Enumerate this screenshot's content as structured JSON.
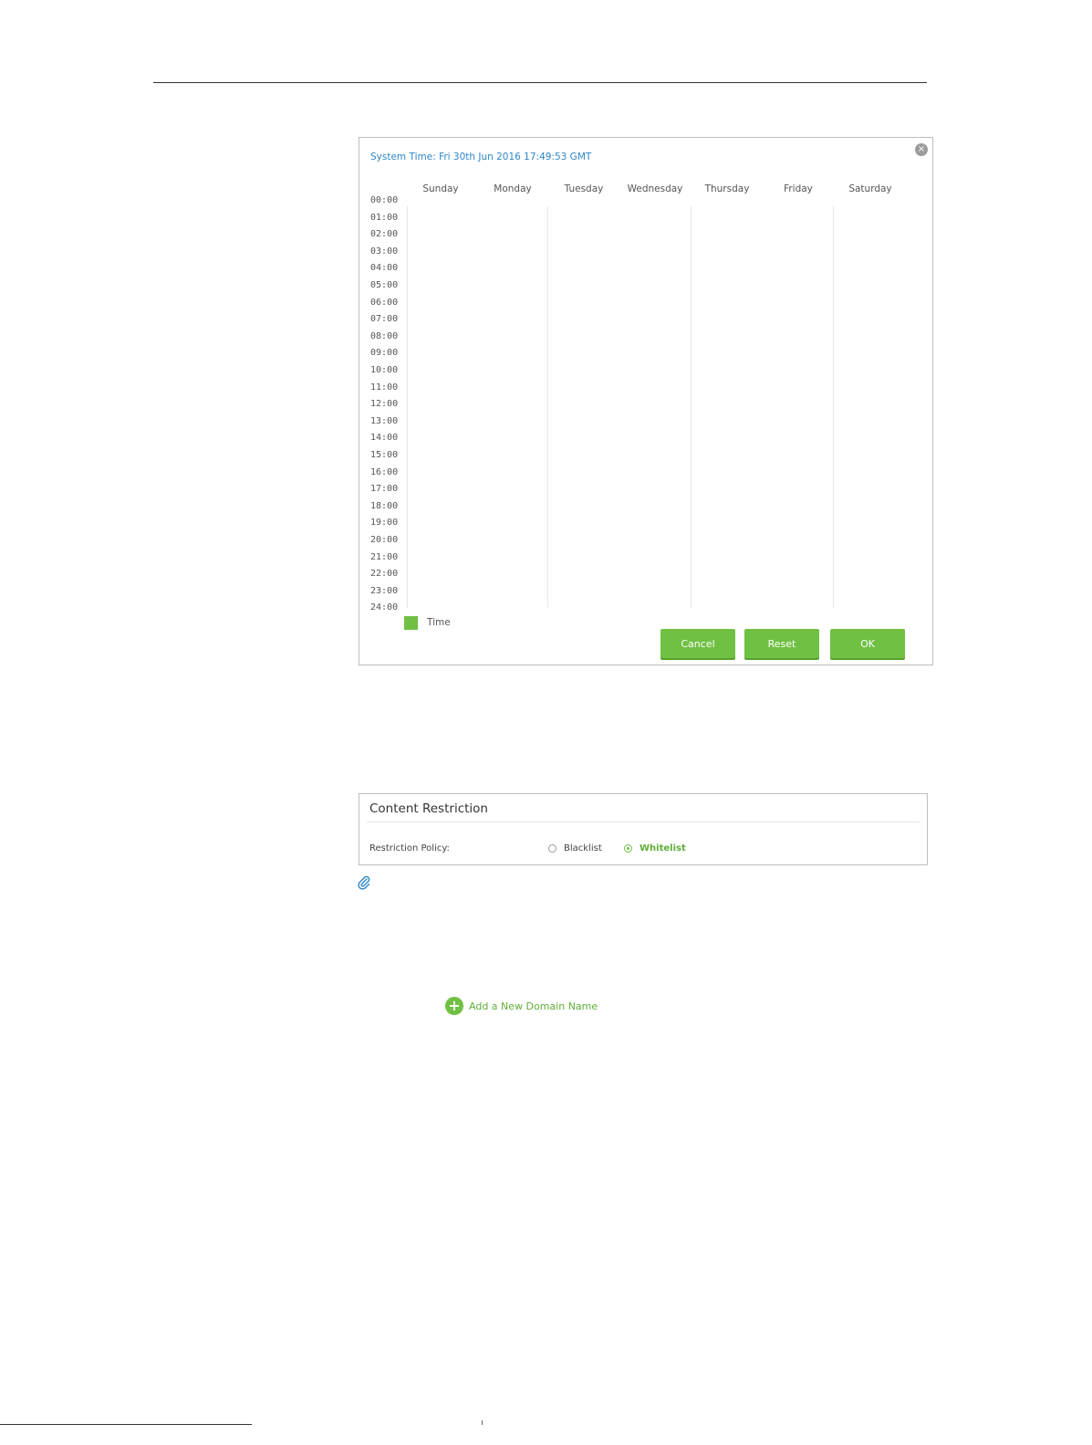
{
  "schedule_dialog": {
    "system_time": "System Time: Fri 30th Jun 2016 17:49:53 GMT",
    "close_icon": "close-icon",
    "days": [
      "Sunday",
      "Monday",
      "Tuesday",
      "Wednesday",
      "Thursday",
      "Friday",
      "Saturday"
    ],
    "hours": [
      "00:00",
      "01:00",
      "02:00",
      "03:00",
      "04:00",
      "05:00",
      "06:00",
      "07:00",
      "08:00",
      "09:00",
      "10:00",
      "11:00",
      "12:00",
      "13:00",
      "14:00",
      "15:00",
      "16:00",
      "17:00",
      "18:00",
      "19:00",
      "20:00",
      "21:00",
      "22:00",
      "23:00",
      "24:00"
    ],
    "legend_label": "Time",
    "legend_color": "#70c043",
    "buttons": {
      "cancel": "Cancel",
      "reset": "Reset",
      "ok": "OK"
    }
  },
  "content_restriction": {
    "title": "Content Restriction",
    "policy_label": "Restriction Policy:",
    "options": [
      {
        "label": "Blacklist",
        "selected": false
      },
      {
        "label": "Whitelist",
        "selected": true
      }
    ]
  },
  "note_icon": "paperclip-icon",
  "add_domain": {
    "label": "Add a New Domain Name",
    "icon": "plus-circle-icon"
  },
  "accent_color": "#70c043",
  "link_color": "#2f86c8"
}
